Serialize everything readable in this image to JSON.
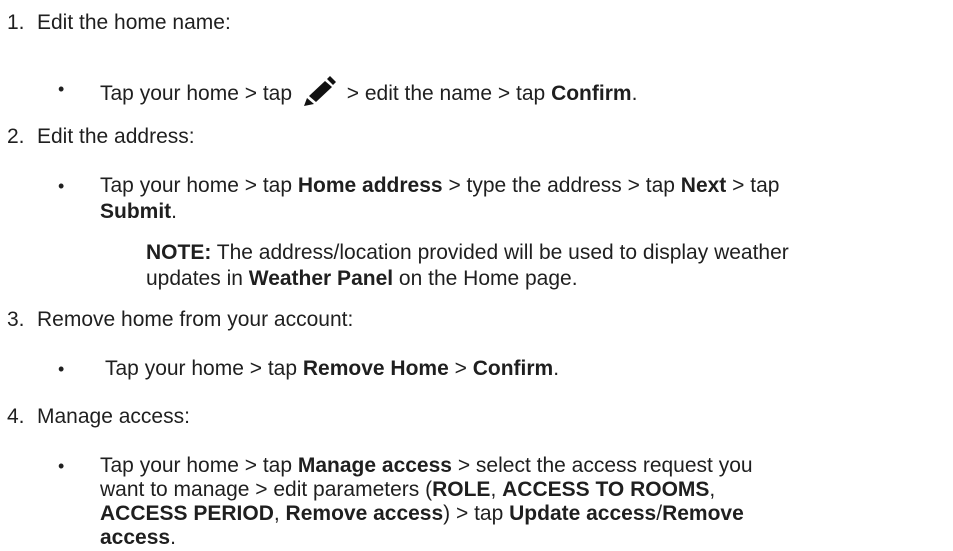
{
  "steps": [
    {
      "number": "1.",
      "title": "Edit the home name:",
      "bullet": {
        "p1": "Tap your home > tap",
        "icon": "pencil-edit-icon",
        "p2": "> edit the name > tap",
        "b1": "Confirm",
        "p3": "."
      }
    },
    {
      "number": "2.",
      "title": "Edit the address:",
      "bullet": {
        "p1": "Tap your home > tap ",
        "b1": "Home address",
        "p2": " > type the address > tap ",
        "b2": "Next",
        "p3": " > tap",
        "b3": "Submit",
        "p4": "."
      },
      "note": {
        "label": "NOTE:",
        "text1": " The address/location provided will be used to display weather",
        "text2": "updates in ",
        "bold": "Weather Panel",
        "text3": " on the Home page."
      }
    },
    {
      "number": "3.",
      "title": "Remove home from your account:",
      "bullet": {
        "p1": "Tap your home > tap ",
        "b1": "Remove Home",
        "p2": " > ",
        "b2": "Confirm",
        "p3": "."
      }
    },
    {
      "number": "4.",
      "title": "Manage access:",
      "bullet": {
        "p1": "Tap your home > tap ",
        "b1": "Manage access",
        "p2": " > select the access request you",
        "p3": "want to manage > edit parameters (",
        "b2": "ROLE",
        "p4": ", ",
        "b3": "ACCESS TO ROOMS",
        "p5": ",",
        "b4": "ACCESS PERIOD",
        "p6": ", ",
        "b5": "Remove access",
        "p7": ") > tap ",
        "b6": "Update access",
        "p8": "/",
        "b7": "Remove",
        "b8": "access",
        "p9": "."
      }
    }
  ],
  "bullet_symbol": "•"
}
